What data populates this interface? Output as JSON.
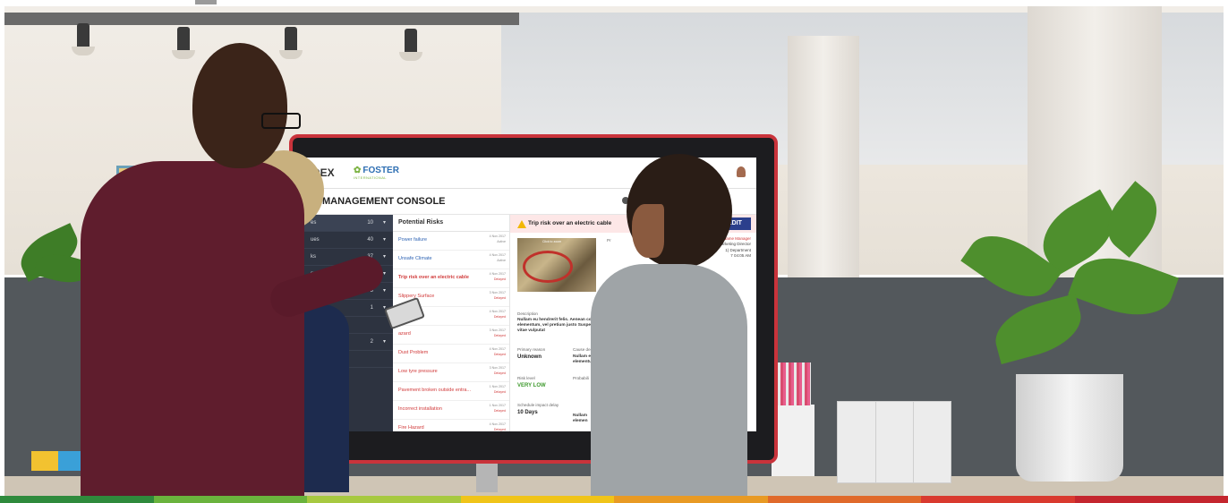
{
  "colors": {
    "stripes": [
      "#2f8a3c",
      "#6ab33d",
      "#a7c940",
      "#f0c419",
      "#e89a24",
      "#e06a2b",
      "#d93a2f",
      "#c4262e"
    ],
    "display_frame": "#c9333b",
    "sidebar": "#2d3340",
    "edit_button": "#2b3f8c"
  },
  "screen": {
    "logo_left": "DEX",
    "logo_right": "FOSTER",
    "logo_right_sub": "INTERNATIONAL",
    "console_title": "K MANAGEMENT CONSOLE",
    "sidebar": [
      {
        "label": "es",
        "count": "10"
      },
      {
        "label": "ues",
        "count": "40"
      },
      {
        "label": "ks",
        "count": "37"
      },
      {
        "label": "ssues",
        "count": "4"
      },
      {
        "label": "Active",
        "count": "3"
      },
      {
        "label": "Closed",
        "count": "1"
      },
      {
        "label": "",
        "count": ""
      },
      {
        "label": "ered",
        "count": "2"
      },
      {
        "label": "y",
        "count": ""
      }
    ],
    "risk_list_title": "Potential Risks",
    "risks": [
      {
        "name": "Power failure",
        "date": "4 Nov 2017",
        "status": "Active"
      },
      {
        "name": "Unsafe Climate",
        "date": "4 Nov 2017",
        "status": "Active"
      },
      {
        "name": "Trip risk over an electric cable",
        "date": "4 Nov 2017",
        "status": "Delayed"
      },
      {
        "name": "Slippery Surface",
        "date": "3 Nov 2017",
        "status": "Delayed"
      },
      {
        "name": "d wiring",
        "date": "4 Nov 2017",
        "status": "Delayed"
      },
      {
        "name": "azard",
        "date": "3 Nov 2017",
        "status": "Delayed"
      },
      {
        "name": "Dust Problem",
        "date": "4 Nov 2017",
        "status": "Delayed"
      },
      {
        "name": "Low tyre pressure",
        "date": "3 Nov 2017",
        "status": "Delayed"
      },
      {
        "name": "Pavement broken outside entra...",
        "date": "1 Nov 2017",
        "status": "Delayed"
      },
      {
        "name": "Incorrect installation",
        "date": "1 Nov 2017",
        "status": "Delayed"
      },
      {
        "name": "Fire Hazard",
        "date": "4 Nov 2017",
        "status": "Delayed"
      }
    ],
    "detail": {
      "title": "Trip risk over an electric cable",
      "edit_label": "EDIT",
      "photo_caption": "Click to zoom",
      "meta_line1": "duc Name Manager",
      "meta_line2": "Marketing Director",
      "meta_line3": "1) Department",
      "meta_line4": "7 04:05 AM",
      "meta_prefix": "Pr",
      "description_label": "Description",
      "description_text": "Nullam eu hendrerit felis. Aenean comm eu lorem elementum, vel pretium justo Suspendisse lacinia, felis vitae vulputat",
      "primary_reason_label": "Primary reason",
      "primary_reason_value": "Unknown",
      "cause_label": "Cause description",
      "cause_text": "Nullam eu h elementum vitae",
      "risk_level_label": "Risk level",
      "risk_level_value": "VERY LOW",
      "probability_label": "Probabili",
      "schedule_label": "Schedule impact delay",
      "schedule_value": "10 Days",
      "trailing_text": "Nullam elemen"
    }
  }
}
